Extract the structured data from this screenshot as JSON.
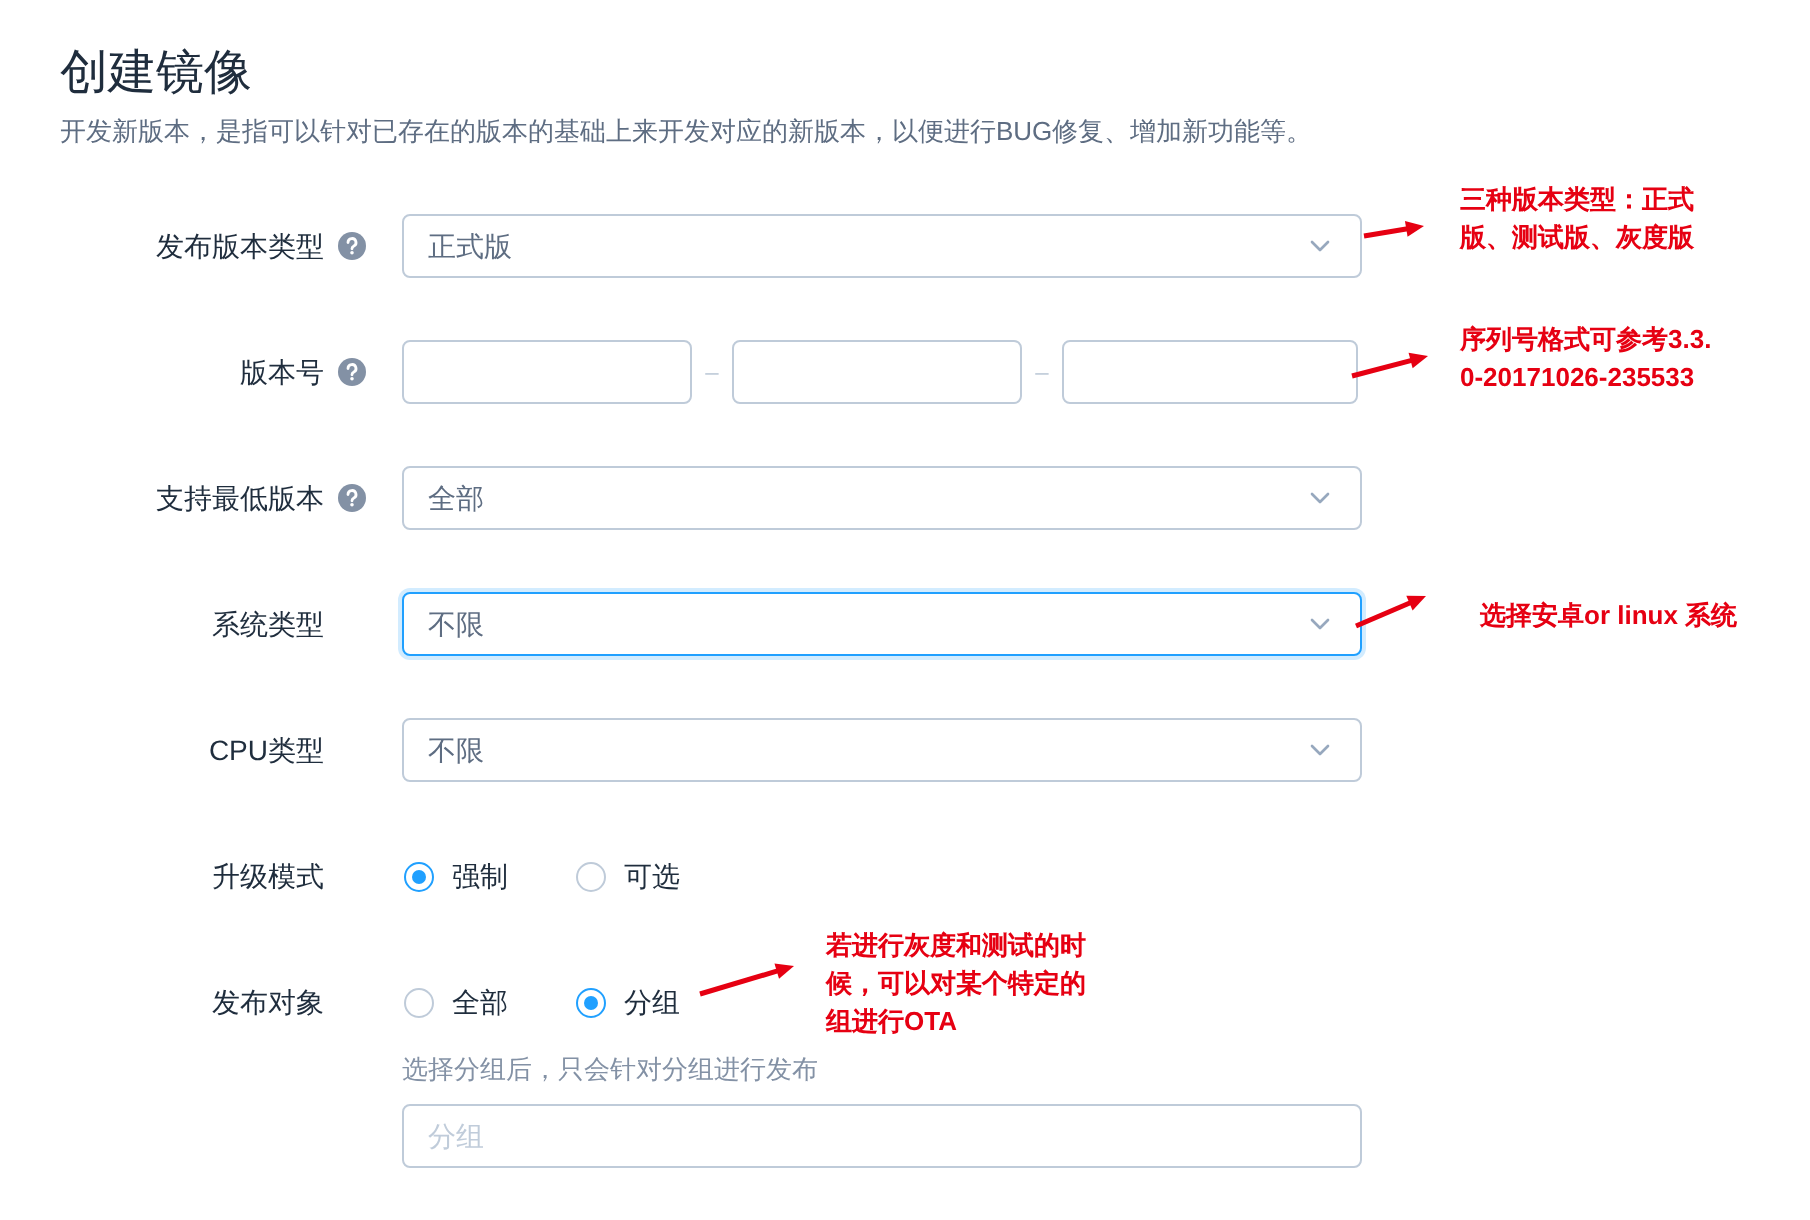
{
  "title": "创建镜像",
  "description": "开发新版本，是指可以针对已存在的版本的基础上来开发对应的新版本，以便进行BUG修复、增加新功能等。",
  "fields": [
    {
      "kind": "select",
      "label": "发布版本类型",
      "help": true,
      "value": "正式版",
      "focused": false
    },
    {
      "kind": "version",
      "label": "版本号",
      "help": true,
      "separators": [
        "–",
        "–"
      ]
    },
    {
      "kind": "select",
      "label": "支持最低版本",
      "help": true,
      "value": "全部",
      "focused": false
    },
    {
      "kind": "select",
      "label": "系统类型",
      "help": false,
      "value": "不限",
      "focused": true
    },
    {
      "kind": "select",
      "label": "CPU类型",
      "help": false,
      "value": "不限",
      "focused": false
    },
    {
      "kind": "radio",
      "label": "升级模式",
      "help": false,
      "options": [
        {
          "label": "强制",
          "selected": true
        },
        {
          "label": "可选",
          "selected": false
        }
      ]
    },
    {
      "kind": "radio",
      "label": "发布对象",
      "help": false,
      "options": [
        {
          "label": "全部",
          "selected": false
        },
        {
          "label": "分组",
          "selected": true
        }
      ],
      "hint": "选择分组后，只会针对分组进行发布",
      "input_placeholder": "分组"
    }
  ],
  "annotations": [
    {
      "text": "三种版本类型：正式版、测试版、灰度版"
    },
    {
      "text": "序列号格式可参考3.3.0-20171026-235533"
    },
    {
      "text": "选择安卓or linux 系统"
    },
    {
      "text": "若进行灰度和测试的时候，可以对某个特定的组进行OTA"
    }
  ]
}
